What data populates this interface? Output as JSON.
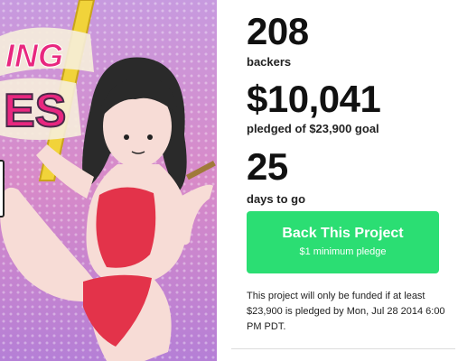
{
  "artwork": {
    "title_fragment_top": "ING",
    "title_fragment_bottom": "ES",
    "colors": {
      "pink_bg": "#d88ac8",
      "purple_bg": "#b58ad8",
      "pole": "#f1d33a",
      "title_pink": "#e8277f",
      "swimsuit": "#e3334a",
      "hair": "#2a2a2a",
      "skin": "#f7dcd6"
    }
  },
  "stats": {
    "backers_count": "208",
    "backers_label": "backers",
    "pledged_amount": "$10,041",
    "pledged_label": "pledged of $23,900 goal",
    "days_count": "25",
    "days_label": "days to go"
  },
  "cta": {
    "title": "Back This Project",
    "subtitle": "$1 minimum pledge",
    "color": "#2bde73"
  },
  "funding_note": "This project will only be funded if at least $23,900 is pledged by Mon, Jul 28 2014 6:00 PM PDT."
}
